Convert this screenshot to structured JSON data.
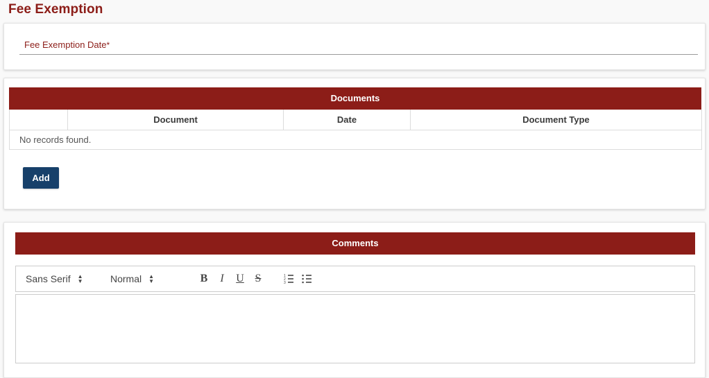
{
  "page": {
    "title": "Fee Exemption",
    "background_color": "#f9f9f9",
    "accent_color": "#8c1d18",
    "button_color": "#17406a"
  },
  "date_section": {
    "label": "Fee Exemption Date",
    "required_marker": "*",
    "value": "",
    "placeholder": ""
  },
  "documents_section": {
    "header": "Documents",
    "columns": [
      {
        "key": "select",
        "label": ""
      },
      {
        "key": "document",
        "label": "Document"
      },
      {
        "key": "date",
        "label": "Date"
      },
      {
        "key": "document_type",
        "label": "Document Type"
      }
    ],
    "rows": [],
    "empty_message": "No records found.",
    "add_label": "Add"
  },
  "comments_section": {
    "header": "Comments",
    "toolbar": {
      "font": {
        "value": "Sans Serif",
        "icon": "chevron-updown-icon"
      },
      "size": {
        "value": "Normal",
        "icon": "chevron-updown-icon"
      },
      "bold": {
        "label": "B",
        "icon": "bold-icon"
      },
      "italic": {
        "label": "I",
        "icon": "italic-icon"
      },
      "underline": {
        "label": "U",
        "icon": "underline-icon"
      },
      "strike": {
        "label": "S",
        "icon": "strikethrough-icon"
      },
      "ordered_list": {
        "icon": "ordered-list-icon"
      },
      "bullet_list": {
        "icon": "bullet-list-icon"
      }
    },
    "body_text": "",
    "body_placeholder": ""
  }
}
